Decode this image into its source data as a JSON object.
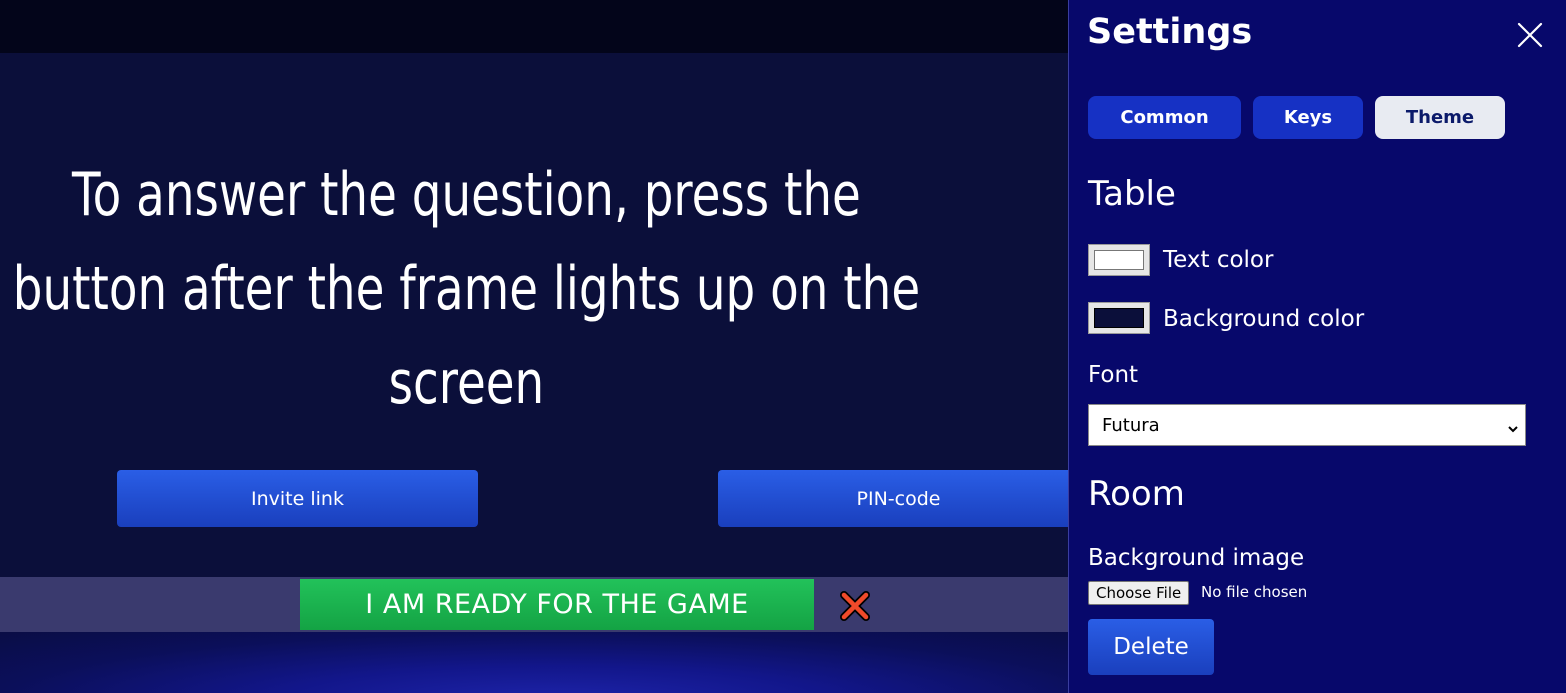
{
  "main": {
    "instruction": "To answer the question, press the button after the frame lights up on the screen",
    "invite_link_label": "Invite link",
    "pin_code_label": "PIN-code",
    "ready_label": "I AM READY FOR THE GAME",
    "cancel_icon": "red-x-icon"
  },
  "settings": {
    "title": "Settings",
    "close_icon": "close-icon",
    "tabs": [
      {
        "label": "Common"
      },
      {
        "label": "Keys"
      },
      {
        "label": "Theme"
      }
    ],
    "active_tab": "Theme",
    "table_section": {
      "title": "Table",
      "text_color_label": "Text color",
      "text_color_value": "#ffffff",
      "background_color_label": "Background color",
      "background_color_value": "#0b0f3a",
      "font_label": "Font",
      "font_selected": "Futura"
    },
    "room_section": {
      "title": "Room",
      "background_image_label": "Background image",
      "choose_file_label": "Choose File",
      "file_status": "No file chosen",
      "delete_label": "Delete"
    }
  },
  "colors": {
    "panel_bg": "#07086b",
    "main_bg": "#0b0f3a",
    "button_blue": "#1f4fd6",
    "ready_green": "#1db450",
    "tab_active_bg": "#e8ebf2"
  }
}
